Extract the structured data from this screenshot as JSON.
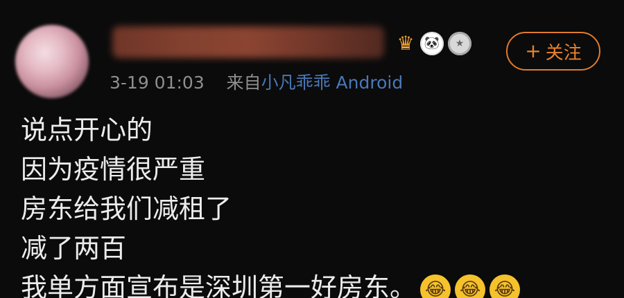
{
  "post": {
    "meta": {
      "date_time": "3-19 01:03",
      "from_prefix": "来自",
      "source_name": "小凡乖乖",
      "source_platform": "Android"
    },
    "follow": {
      "plus": "+",
      "label": "关注"
    },
    "badges": [
      "crown-badge",
      "panda-badge",
      "medal-badge"
    ],
    "text_lines": [
      "说点开心的",
      "因为疫情很严重",
      "房东给我们减租了",
      "减了两百",
      "我单方面宣布是深圳第一好房东。"
    ],
    "emojis": [
      "laugh-cry-emoji",
      "laugh-cry-emoji",
      "laugh-cry-emoji"
    ]
  },
  "colors": {
    "background": "#0b0b0b",
    "accent": "#e8832f",
    "link": "#4a78b8",
    "meta": "#8f8f8f",
    "text": "#ececec"
  }
}
